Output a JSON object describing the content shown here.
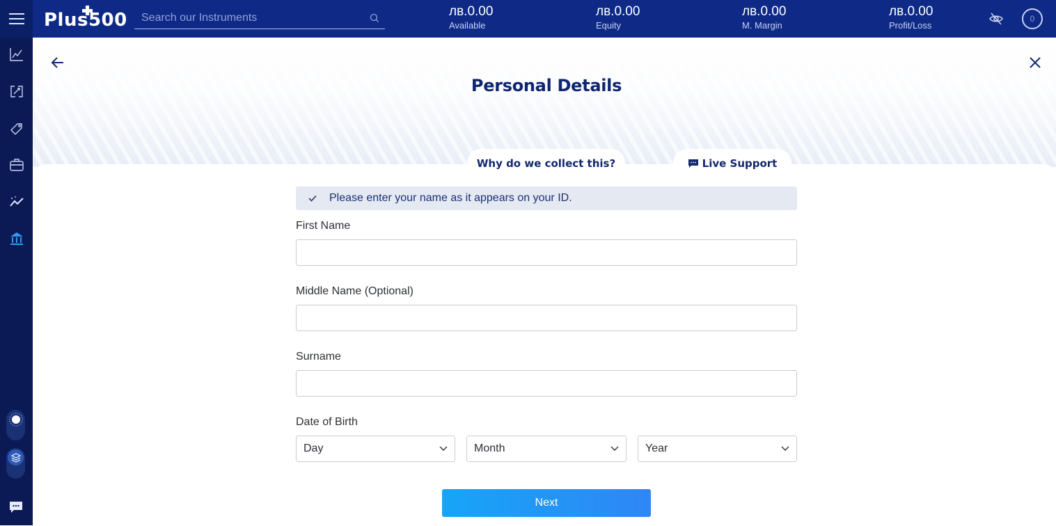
{
  "topbar": {
    "brand": "Plus500",
    "search": {
      "placeholder": "Search our Instruments",
      "value": ""
    },
    "stats": [
      {
        "value": "лв.0.00",
        "label": "Available"
      },
      {
        "value": "лв.0.00",
        "label": "Equity"
      },
      {
        "value": "лв.0.00",
        "label": "M. Margin"
      },
      {
        "value": "лв.0.00",
        "label": "Profit/Loss"
      }
    ],
    "notification_count": "0"
  },
  "sidebar": {
    "items": [
      {
        "icon": "chart-line-icon",
        "label": "Trade"
      },
      {
        "icon": "swap-icon",
        "label": "Positions"
      },
      {
        "icon": "tag-icon",
        "label": "Orders"
      },
      {
        "icon": "briefcase-icon",
        "label": "Portfolio"
      },
      {
        "icon": "trend-sparkle-icon",
        "label": "Insights"
      },
      {
        "icon": "bank-icon",
        "label": "Funds",
        "active": true
      }
    ],
    "theme_toggle_icon": "sun-icon",
    "mode_toggle_icon": "layers-icon",
    "chat_icon": "chat-icon"
  },
  "page": {
    "title": "Personal Details",
    "why_label": "Why do we collect this?",
    "support_label": "Live Support",
    "hint": "Please enter your name as it appears on your ID.",
    "fields": {
      "first_name": {
        "label": "First Name",
        "value": ""
      },
      "middle_name": {
        "label": "Middle Name (Optional)",
        "value": ""
      },
      "surname": {
        "label": "Surname",
        "value": ""
      }
    },
    "dob": {
      "label": "Date of Birth",
      "day": "Day",
      "month": "Month",
      "year": "Year"
    },
    "next_label": "Next"
  },
  "colors": {
    "topbar": "#0e2a86",
    "sidebar": "#0b1a55",
    "accent": "#2196f3",
    "title": "#0e2670"
  }
}
